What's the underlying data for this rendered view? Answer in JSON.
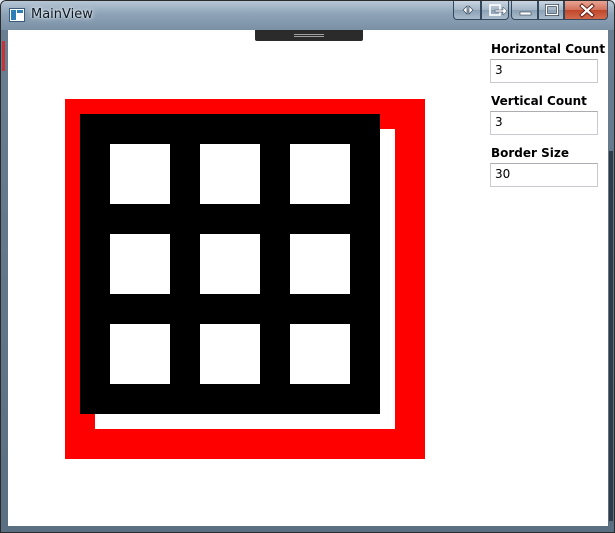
{
  "window": {
    "title": "MainView"
  },
  "caption_buttons": {
    "extra1_icon": "left-right-arrows-icon",
    "extra2_icon": "exit-icon",
    "minimize_icon": "minimize-icon",
    "maximize_icon": "maximize-icon",
    "close_icon": "close-icon"
  },
  "panel": {
    "horizontal_count": {
      "label": "Horizontal Count",
      "value": "3"
    },
    "vertical_count": {
      "label": "Vertical Count",
      "value": "3"
    },
    "border_size": {
      "label": "Border Size",
      "value": "30"
    }
  },
  "colors": {
    "frame": "#ff0000",
    "grid": "#000000",
    "cell": "#ffffff",
    "background": "#ffffff"
  }
}
